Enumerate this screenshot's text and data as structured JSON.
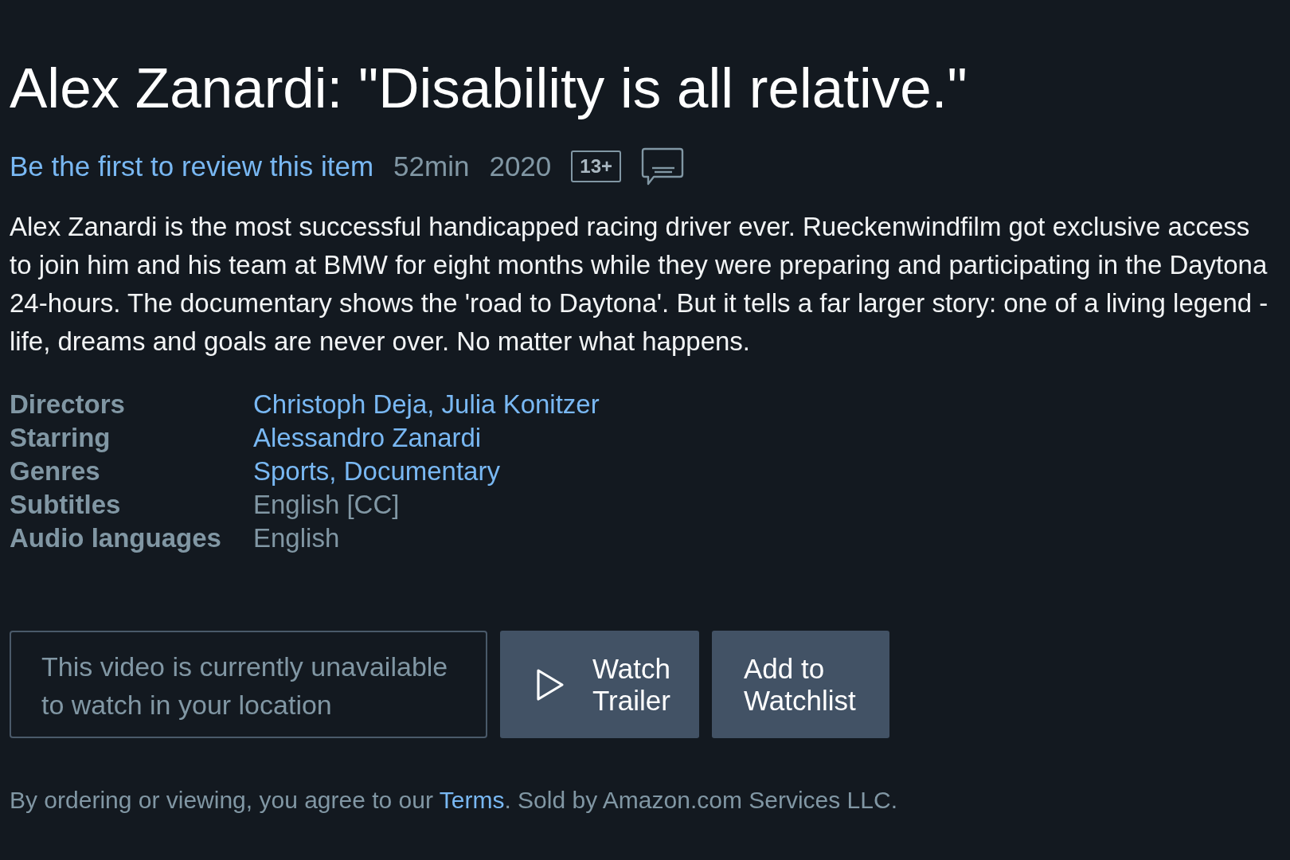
{
  "title": "Alex Zanardi: \"Disability is all relative.\"",
  "meta": {
    "review_link": "Be the first to review this item",
    "runtime": "52min",
    "year": "2020",
    "rating": "13+"
  },
  "description": "Alex Zanardi is the most successful handicapped racing driver ever. Rueckenwindfilm got exclusive access to join him and his team at BMW for eight months while they were preparing and participating in the Daytona 24-hours. The documentary shows the 'road to Daytona'. But it tells a far larger story: one of a living legend - life, dreams and goals are never over. No matter what happens.",
  "details": [
    {
      "label": "Directors",
      "value": "Christoph Deja, Julia Konitzer",
      "kind": "link"
    },
    {
      "label": "Starring",
      "value": "Alessandro Zanardi",
      "kind": "link"
    },
    {
      "label": "Genres",
      "value": "Sports, Documentary",
      "kind": "link"
    },
    {
      "label": "Subtitles",
      "value": "English [CC]",
      "kind": "text"
    },
    {
      "label": "Audio languages",
      "value": "English",
      "kind": "text"
    }
  ],
  "availability": "This video is currently unavailable to watch in your location",
  "buttons": [
    {
      "label": "Watch Trailer",
      "kind": "play"
    },
    {
      "label": "Add to Watchlist",
      "kind": "plain"
    }
  ],
  "footer": {
    "before": "By ordering or viewing, you agree to our",
    "link": "Terms",
    "after": ". Sold by Amazon.com Services LLC."
  }
}
